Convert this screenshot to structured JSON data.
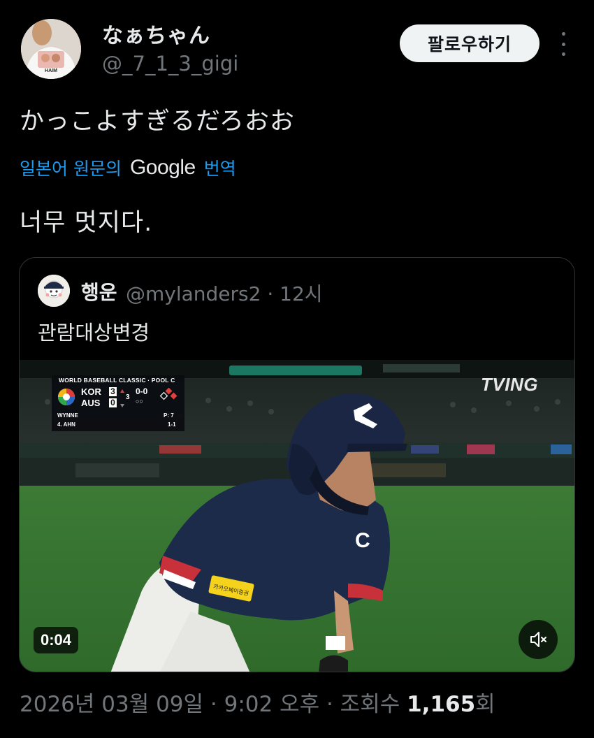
{
  "author": {
    "display_name": "なぁちゃん",
    "handle": "@_7_1_3_gigi",
    "avatar_shirt_text": "HAIM"
  },
  "follow_label": "팔로우하기",
  "tweet": {
    "text": "かっこよすぎるだろおお",
    "translate_prefix": "일본어 원문의",
    "translate_brand": "Google",
    "translate_suffix": "번역",
    "translated_text": "너무 멋지다."
  },
  "quoted": {
    "display_name": "행운",
    "handle_time": "@mylanders2 · 12시",
    "text": "관람대상변경",
    "video": {
      "duration": "0:04",
      "watermark": "TVING",
      "scorebug": {
        "title": "WORLD BASEBALL CLASSIC · POOL C",
        "team1": "KOR",
        "score1": "3",
        "team2": "AUS",
        "score2": "0",
        "inning": "3",
        "count": "0-0",
        "outs": "○○",
        "pitcher": "WYNNE",
        "pitch_count": "P: 7",
        "batter": "4. AHN",
        "batter_line": "1-1"
      },
      "jersey_letter": "C",
      "sponsor_patch": "카카오페이증권"
    }
  },
  "meta": {
    "date_time": "2026년 03월 09일 · 9:02 오후 · 조회수",
    "views": "1,165",
    "views_suffix": "회"
  },
  "colors": {
    "background": "#000000",
    "text_primary": "#e7e9ea",
    "text_secondary": "#71767b",
    "link": "#1d9bf0",
    "follow_bg": "#eff3f4",
    "border": "#2f3336"
  },
  "icons": {
    "more": "more-vertical-icon",
    "mute": "speaker-muted-icon",
    "wbc_logo": "wbc-logo-icon"
  }
}
